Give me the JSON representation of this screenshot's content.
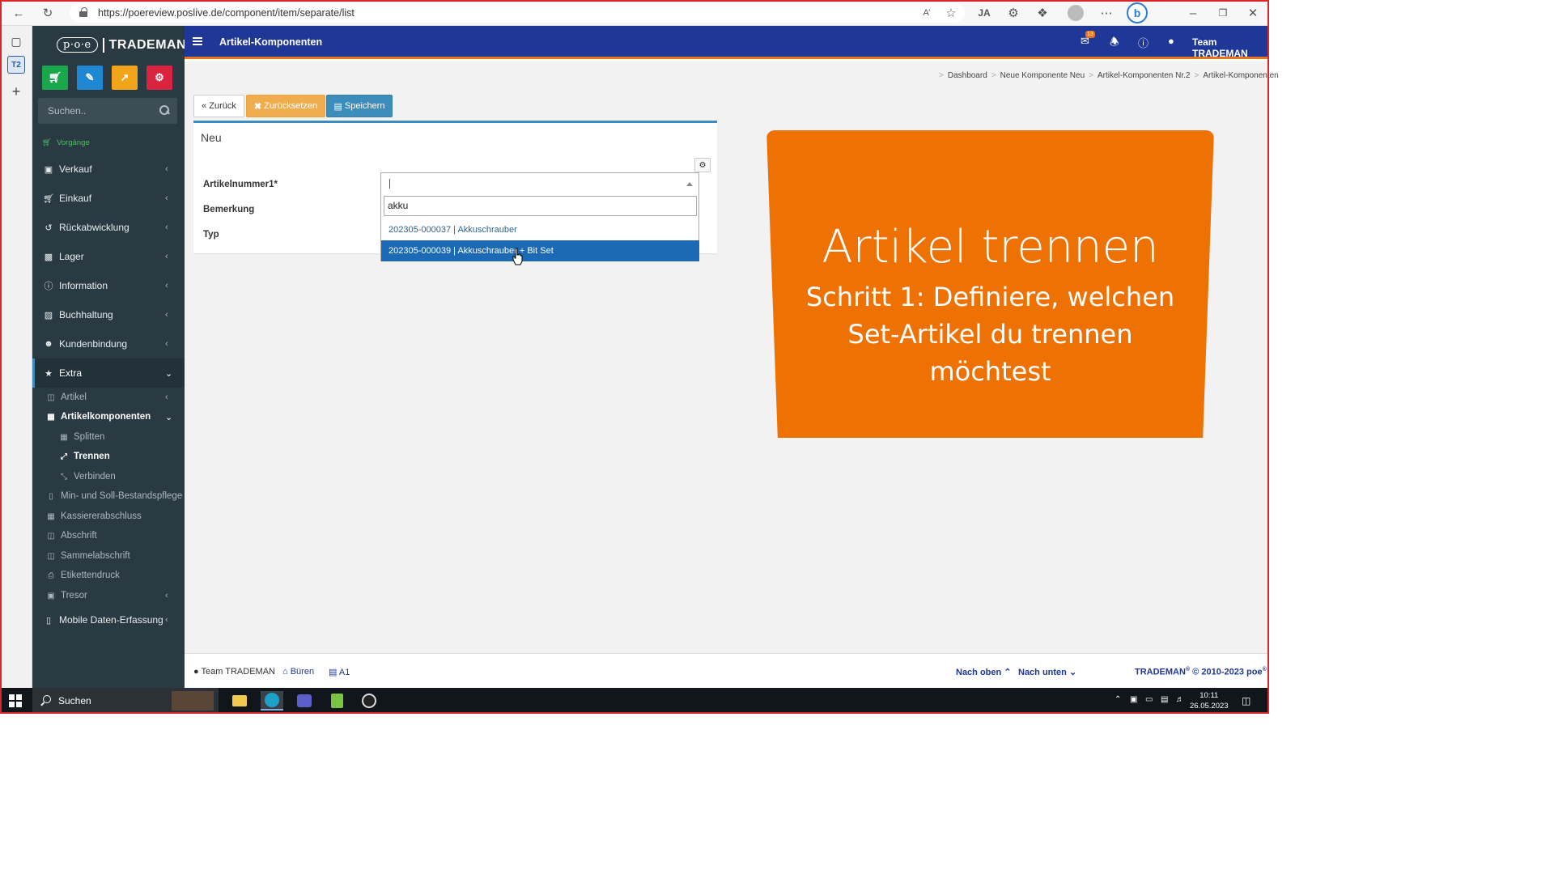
{
  "browser": {
    "url": "https://poereview.poslive.de/component/item/separate/list",
    "read_aloud_icon": "read-aloud-icon",
    "favorites_icon": "favorites-icon"
  },
  "sidebar": {
    "logo_poe": "p·o·e",
    "logo_trademan": "TRADEMAN",
    "search_placeholder": "Suchen..",
    "section_label": "Vorgänge",
    "items": [
      {
        "label": "Verkauf",
        "icon": "monitor-icon"
      },
      {
        "label": "Einkauf",
        "icon": "cart-icon"
      },
      {
        "label": "Rückabwicklung",
        "icon": "undo-icon"
      },
      {
        "label": "Lager",
        "icon": "truck-icon"
      },
      {
        "label": "Information",
        "icon": "info-icon"
      },
      {
        "label": "Buchhaltung",
        "icon": "money-icon"
      },
      {
        "label": "Kundenbindung",
        "icon": "users-icon"
      },
      {
        "label": "Extra",
        "icon": "star-icon"
      }
    ],
    "extra_sub": [
      {
        "label": "Artikel",
        "icon": "cube-icon"
      },
      {
        "label": "Artikelkomponenten",
        "icon": "grid-icon"
      },
      {
        "label": "Splitten",
        "icon": "table-icon"
      },
      {
        "label": "Trennen",
        "icon": "expand-icon"
      },
      {
        "label": "Verbinden",
        "icon": "compress-icon"
      },
      {
        "label": "Min- und Soll-Bestandspflege",
        "icon": "file-icon"
      },
      {
        "label": "Kassiererabschluss",
        "icon": "calculator-icon"
      },
      {
        "label": "Abschrift",
        "icon": "trash-icon"
      },
      {
        "label": "Sammelabschrift",
        "icon": "trash-icon"
      },
      {
        "label": "Etikettendruck",
        "icon": "print-icon"
      },
      {
        "label": "Tresor",
        "icon": "safe-icon"
      }
    ],
    "mobile": {
      "label": "Mobile Daten-Erfassung",
      "icon": "mobile-icon"
    }
  },
  "topbar": {
    "title": "Artikel-Komponenten",
    "mail_count": "13",
    "user": "Team TRADEMAN"
  },
  "breadcrumb": [
    "Dashboard",
    "Neue Komponente Neu",
    "Artikel-Komponenten Nr.2",
    "Artikel-Komponenten"
  ],
  "actions": {
    "back": "Zurück",
    "reset": "Zurücksetzen",
    "save": "Speichern"
  },
  "form": {
    "panel_title": "Neu",
    "label_artikelnummer": "Artikelnummer1*",
    "label_bemerkung": "Bemerkung",
    "label_typ": "Typ",
    "search_value": "akku",
    "options": [
      "202305-000037 | Akkuschrauber",
      "202305-000039 | Akkuschrauber + Bit Set"
    ]
  },
  "promo": {
    "title": "Artikel trennen",
    "subtitle": "Schritt 1: Definiere, welchen Set-Artikel du trennen möchtest"
  },
  "footer": {
    "user": "Team TRADEMAN",
    "location": "Büren",
    "device": "A1",
    "nach_oben": "Nach oben",
    "nach_unten": "Nach unten",
    "copyright_brand": "TRADEMAN",
    "copyright_reg": "®",
    "copyright_years": " © 2010-2023 ",
    "copyright_poe": "poe"
  },
  "taskbar": {
    "search_label": "Suchen",
    "time": "10:11",
    "date": "26.05.2023"
  },
  "colors": {
    "topbar": "#1f3797",
    "accent_orange": "#ee7104",
    "sidebar": "#2a3a42",
    "selected_option": "#1c69b5"
  }
}
